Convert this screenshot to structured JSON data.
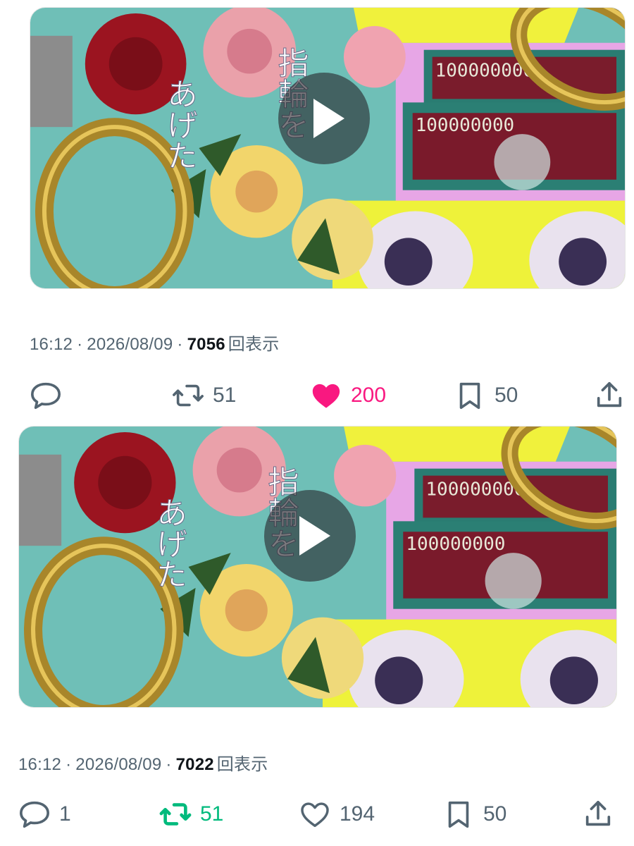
{
  "posts": [
    {
      "time": "16:12",
      "date": "2026/08/09",
      "views": "7056",
      "views_suffix": "回表示",
      "reply_count": "",
      "retweet_count": "51",
      "like_count": "200",
      "bookmark_count": "50",
      "liked": true,
      "retweeted": false
    },
    {
      "time": "16:12",
      "date": "2026/08/09",
      "views": "7022",
      "views_suffix": "回表示",
      "reply_count": "1",
      "retweet_count": "51",
      "like_count": "194",
      "bookmark_count": "50",
      "liked": false,
      "retweeted": true
    }
  ],
  "video_caption": {
    "left": "あげた",
    "right": "指輪を"
  },
  "banknote_text": "100000000",
  "colors": {
    "muted": "#536471",
    "like_active": "#f91880",
    "retweet_active": "#00ba7c",
    "text": "#0f1419"
  },
  "icons": [
    "reply-icon",
    "retweet-icon",
    "heart-icon",
    "bookmark-icon",
    "share-icon",
    "play-icon"
  ]
}
